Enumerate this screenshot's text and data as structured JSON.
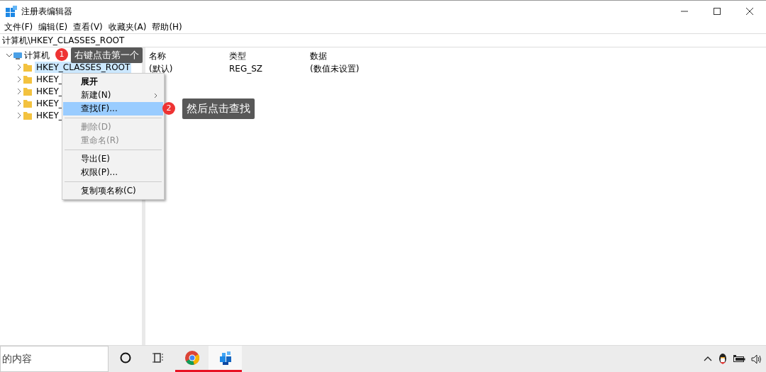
{
  "window": {
    "title": "注册表编辑器"
  },
  "menu_bar": [
    "文件(F)",
    "编辑(E)",
    "查看(V)",
    "收藏夹(A)",
    "帮助(H)"
  ],
  "address_bar": {
    "value": "计算机\\HKEY_CLASSES_ROOT"
  },
  "tree": {
    "label": "计算机",
    "expanded": true,
    "children": [
      {
        "label": "HKEY_CLASSES_ROOT",
        "selected": true,
        "expanded": false
      },
      {
        "label": "HKEY_",
        "selected": false,
        "expanded": false
      },
      {
        "label": "HKEY_",
        "selected": false,
        "expanded": false
      },
      {
        "label": "HKEY_",
        "selected": false,
        "expanded": false
      },
      {
        "label": "HKEY_",
        "selected": false,
        "expanded": false
      }
    ]
  },
  "values_table": {
    "columns": [
      "名称",
      "类型",
      "数据"
    ],
    "rows": [
      {
        "cells": [
          "(默认)",
          "REG_SZ",
          "(数值未设置)"
        ]
      }
    ]
  },
  "context_menu": [
    {
      "kind": "item",
      "label": "展开",
      "bold": true,
      "disabled": false,
      "selected": false,
      "submenu": false
    },
    {
      "kind": "item",
      "label": "新建(N)",
      "bold": false,
      "disabled": false,
      "selected": false,
      "submenu": true
    },
    {
      "kind": "item",
      "label": "查找(F)...",
      "bold": false,
      "disabled": false,
      "selected": true,
      "submenu": false
    },
    {
      "kind": "separator"
    },
    {
      "kind": "item",
      "label": "删除(D)",
      "bold": false,
      "disabled": true,
      "selected": false,
      "submenu": false
    },
    {
      "kind": "item",
      "label": "重命名(R)",
      "bold": false,
      "disabled": true,
      "selected": false,
      "submenu": false
    },
    {
      "kind": "separator"
    },
    {
      "kind": "item",
      "label": "导出(E)",
      "bold": false,
      "disabled": false,
      "selected": false,
      "submenu": false
    },
    {
      "kind": "item",
      "label": "权限(P)...",
      "bold": false,
      "disabled": false,
      "selected": false,
      "submenu": false
    },
    {
      "kind": "separator"
    },
    {
      "kind": "item",
      "label": "复制项名称(C)",
      "bold": false,
      "disabled": false,
      "selected": false,
      "submenu": false
    }
  ],
  "annotations": [
    {
      "number": "1",
      "text": "右键点击第一个"
    },
    {
      "number": "2",
      "text": "然后点击查找"
    }
  ],
  "taskbar": {
    "search": {
      "placeholder": "的内容"
    },
    "apps": [
      {
        "kind": "cortana",
        "active": false,
        "focused": false
      },
      {
        "kind": "task-view",
        "active": false,
        "focused": false
      },
      {
        "kind": "browser",
        "active": true,
        "focused": false
      },
      {
        "kind": "registry",
        "active": true,
        "focused": true
      }
    ],
    "tray": [
      {
        "kind": "caret"
      },
      {
        "kind": "penguin"
      },
      {
        "kind": "battery"
      },
      {
        "kind": "volume"
      }
    ]
  }
}
